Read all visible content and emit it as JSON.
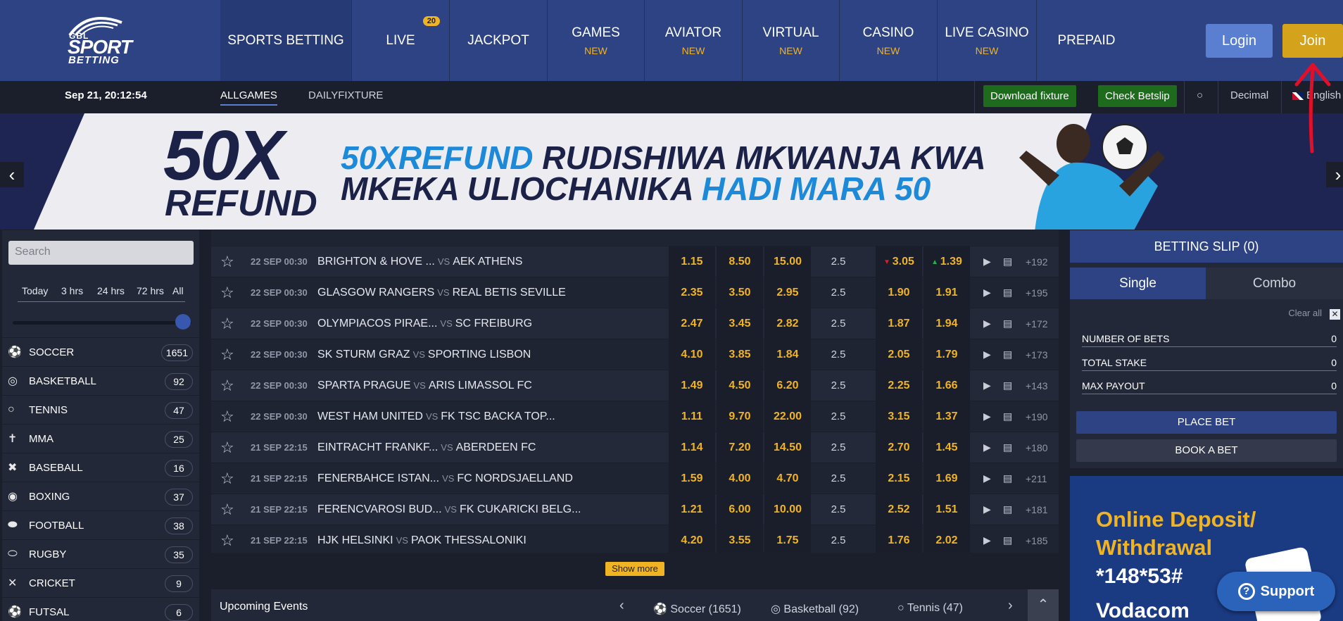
{
  "logo": {
    "line1": "GBL",
    "line2": "SPORT",
    "line3": "BETTING"
  },
  "nav": [
    {
      "label": "SPORTS BETTING",
      "sub": "",
      "badge": ""
    },
    {
      "label": "LIVE",
      "sub": "",
      "badge": "20"
    },
    {
      "label": "JACKPOT",
      "sub": "",
      "badge": ""
    },
    {
      "label": "GAMES",
      "sub": "NEW",
      "badge": ""
    },
    {
      "label": "AVIATOR",
      "sub": "NEW",
      "badge": ""
    },
    {
      "label": "VIRTUAL",
      "sub": "NEW",
      "badge": ""
    },
    {
      "label": "CASINO",
      "sub": "NEW",
      "badge": ""
    },
    {
      "label": "LIVE CASINO",
      "sub": "NEW",
      "badge": ""
    },
    {
      "label": "PREPAID",
      "sub": "",
      "badge": ""
    }
  ],
  "auth": {
    "login": "Login",
    "join": "Join"
  },
  "subnav": {
    "datetime": "Sep 21, 20:12:54",
    "tabs": [
      "ALLGAMES",
      "DAILYFIXTURE"
    ],
    "download_fixture": "Download fixture",
    "check_betslip": "Check Betslip",
    "odds_format": "Decimal",
    "language": "English"
  },
  "banner": {
    "big1": "50X",
    "big2": "REFUND",
    "line1_hl": "50XREFUND",
    "line1_rest": " RUDISHIWA MKWANJA KWA",
    "line2_rest": "MKEKA ULIOCHANIKA ",
    "line2_hl": "HADI MARA 50"
  },
  "sidebar": {
    "search_placeholder": "Search",
    "time_filters": [
      "Today",
      "3 hrs",
      "24 hrs",
      "72 hrs",
      "All"
    ],
    "sports": [
      {
        "name": "SOCCER",
        "count": "1651",
        "icon": "soccer-icon"
      },
      {
        "name": "BASKETBALL",
        "count": "92",
        "icon": "basketball-icon"
      },
      {
        "name": "TENNIS",
        "count": "47",
        "icon": "tennis-icon"
      },
      {
        "name": "MMA",
        "count": "25",
        "icon": "mma-icon"
      },
      {
        "name": "BASEBALL",
        "count": "16",
        "icon": "baseball-icon"
      },
      {
        "name": "BOXING",
        "count": "37",
        "icon": "boxing-icon"
      },
      {
        "name": "FOOTBALL",
        "count": "38",
        "icon": "football-icon"
      },
      {
        "name": "RUGBY",
        "count": "35",
        "icon": "rugby-icon"
      },
      {
        "name": "CRICKET",
        "count": "9",
        "icon": "cricket-icon"
      },
      {
        "name": "FUTSAL",
        "count": "6",
        "icon": "futsal-icon"
      }
    ]
  },
  "matches": [
    {
      "date": "22 SEP 00:30",
      "home": "BRIGHTON & HOVE ...",
      "away": "AEK ATHENS",
      "o1": "1.15",
      "ox": "8.50",
      "o2": "15.00",
      "line": "2.5",
      "over": "3.05",
      "under": "1.39",
      "over_trend": "down",
      "under_trend": "up",
      "more": "+192"
    },
    {
      "date": "22 SEP 00:30",
      "home": "GLASGOW RANGERS",
      "away": "REAL BETIS SEVILLE",
      "o1": "2.35",
      "ox": "3.50",
      "o2": "2.95",
      "line": "2.5",
      "over": "1.90",
      "under": "1.91",
      "more": "+195"
    },
    {
      "date": "22 SEP 00:30",
      "home": "OLYMPIACOS PIRAE...",
      "away": "SC FREIBURG",
      "o1": "2.47",
      "ox": "3.45",
      "o2": "2.82",
      "line": "2.5",
      "over": "1.87",
      "under": "1.94",
      "more": "+172"
    },
    {
      "date": "22 SEP 00:30",
      "home": "SK STURM GRAZ",
      "away": "SPORTING LISBON",
      "o1": "4.10",
      "ox": "3.85",
      "o2": "1.84",
      "line": "2.5",
      "over": "2.05",
      "under": "1.79",
      "more": "+173"
    },
    {
      "date": "22 SEP 00:30",
      "home": "SPARTA PRAGUE",
      "away": "ARIS LIMASSOL FC",
      "o1": "1.49",
      "ox": "4.50",
      "o2": "6.20",
      "line": "2.5",
      "over": "2.25",
      "under": "1.66",
      "more": "+143"
    },
    {
      "date": "22 SEP 00:30",
      "home": "WEST HAM UNITED",
      "away": "FK TSC BACKA TOP...",
      "o1": "1.11",
      "ox": "9.70",
      "o2": "22.00",
      "line": "2.5",
      "over": "3.15",
      "under": "1.37",
      "more": "+190"
    },
    {
      "date": "21 SEP 22:15",
      "home": "EINTRACHT FRANKF...",
      "away": "ABERDEEN FC",
      "o1": "1.14",
      "ox": "7.20",
      "o2": "14.50",
      "line": "2.5",
      "over": "2.70",
      "under": "1.45",
      "more": "+180"
    },
    {
      "date": "21 SEP 22:15",
      "home": "FENERBAHCE ISTAN...",
      "away": "FC NORDSJAELLAND",
      "o1": "1.59",
      "ox": "4.00",
      "o2": "4.70",
      "line": "2.5",
      "over": "2.15",
      "under": "1.69",
      "more": "+211"
    },
    {
      "date": "21 SEP 22:15",
      "home": "FERENCVAROSI BUD...",
      "away": "FK CUKARICKI BELG...",
      "o1": "1.21",
      "ox": "6.00",
      "o2": "10.00",
      "line": "2.5",
      "over": "2.52",
      "under": "1.51",
      "more": "+181"
    },
    {
      "date": "21 SEP 22:15",
      "home": "HJK HELSINKI",
      "away": "PAOK THESSALONIKI",
      "o1": "4.20",
      "ox": "3.55",
      "o2": "1.75",
      "line": "2.5",
      "over": "1.76",
      "under": "2.02",
      "more": "+185"
    }
  ],
  "vs_label": "VS",
  "show_more": "Show more",
  "upcoming": {
    "title": "Upcoming Events",
    "tabs": [
      "Soccer (1651)",
      "Basketball (92)",
      "Tennis (47)"
    ]
  },
  "slip": {
    "title": "BETTING SLIP (0)",
    "tab_single": "Single",
    "tab_combo": "Combo",
    "clear_all": "Clear all",
    "rows": [
      {
        "label": "NUMBER OF BETS",
        "value": "0"
      },
      {
        "label": "TOTAL STAKE",
        "value": "0"
      },
      {
        "label": "MAX PAYOUT",
        "value": "0"
      }
    ],
    "place_bet": "PLACE BET",
    "book_bet": "BOOK A BET"
  },
  "promo": {
    "line1": "Online Deposit/",
    "line2": "Withdrawal",
    "line3": "*148*53#",
    "line4": "Vodacom"
  },
  "support": "Support",
  "colors": {
    "brand": "#2e4384",
    "accent": "#f0b323",
    "login": "#5a7fd1",
    "join": "#d4a21b",
    "annotation": "#e0102a"
  }
}
